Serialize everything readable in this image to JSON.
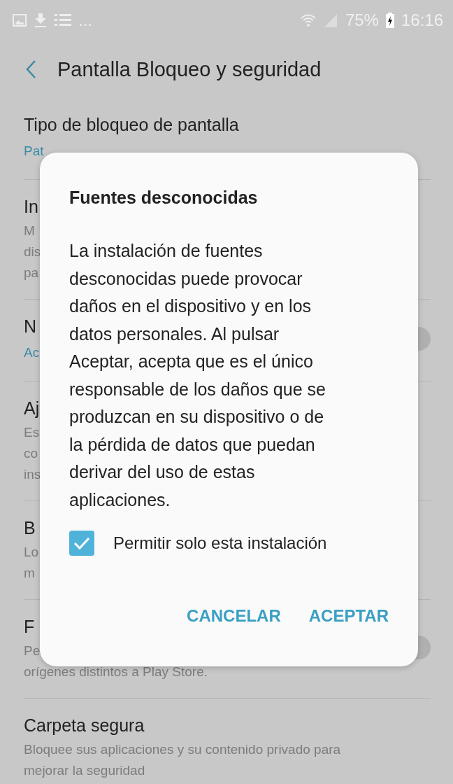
{
  "status_bar": {
    "more": "...",
    "battery": "75%",
    "time": "16:16"
  },
  "header": {
    "title": "Pantalla Bloqueo y seguridad"
  },
  "settings": [
    {
      "title": "Tipo de bloqueo de pantalla",
      "subtitle": "Pat"
    },
    {
      "title": "In",
      "description": [
        "M",
        "dis",
        "pa"
      ]
    },
    {
      "title": "N",
      "subtitle": "Ac",
      "toggle": {
        "on": false
      }
    },
    {
      "title": "Aj",
      "description": [
        "Es",
        "co",
        "ins"
      ]
    },
    {
      "title": "B",
      "description": [
        "Lo",
        "m"
      ]
    },
    {
      "title": "F",
      "description": [
        "Pe",
        "orígenes distintos a Play Store."
      ],
      "toggle": {
        "on": false
      }
    },
    {
      "title": "Carpeta segura",
      "description": [
        "Bloquee sus aplicaciones y su contenido privado para",
        "mejorar la seguridad"
      ]
    }
  ],
  "dialog": {
    "title": "Fuentes desconocidas",
    "message": "La instalación de fuentes desconocidas puede provocar daños en el dispositivo y en los datos personales. Al pulsar Aceptar, acepta que es el único responsable de los daños que se produzcan en su dispositivo o de la pérdida de datos que puedan derivar del uso de estas aplicaciones.",
    "checkbox": {
      "label": "Permitir solo esta instalación",
      "checked": true
    },
    "buttons": [
      "CANCELAR",
      "ACEPTAR"
    ]
  }
}
